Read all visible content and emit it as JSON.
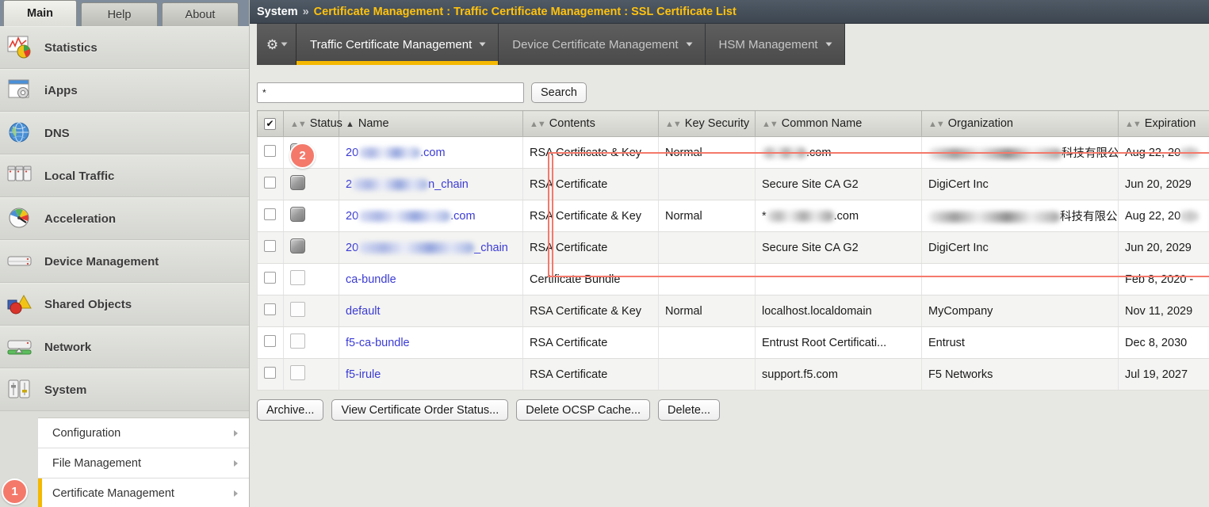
{
  "sidebar": {
    "tabs": [
      {
        "label": "Main",
        "active": true
      },
      {
        "label": "Help",
        "active": false
      },
      {
        "label": "About",
        "active": false
      }
    ],
    "modules": [
      {
        "label": "Statistics",
        "icon": "statistics-chart-icon"
      },
      {
        "label": "iApps",
        "icon": "iapps-window-gear-icon"
      },
      {
        "label": "DNS",
        "icon": "dns-globe-icon"
      },
      {
        "label": "Local Traffic",
        "icon": "local-traffic-servers-icon"
      },
      {
        "label": "Acceleration",
        "icon": "acceleration-gauge-icon"
      },
      {
        "label": "Device Management",
        "icon": "device-management-server-icon"
      },
      {
        "label": "Shared Objects",
        "icon": "shared-objects-shapes-icon"
      },
      {
        "label": "Network",
        "icon": "network-server-icon"
      },
      {
        "label": "System",
        "icon": "system-sliders-icon"
      }
    ],
    "submenu": [
      {
        "label": "Configuration",
        "highlight": false
      },
      {
        "label": "File Management",
        "highlight": false
      },
      {
        "label": "Certificate Management",
        "highlight": true
      }
    ]
  },
  "header": {
    "breadcrumb_root": "System",
    "breadcrumb_separator": "»",
    "breadcrumb_path": "Certificate Management : Traffic Certificate Management : SSL Certificate List"
  },
  "module_tabs": [
    {
      "label": "Traffic Certificate Management",
      "active": true
    },
    {
      "label": "Device Certificate Management",
      "active": false
    },
    {
      "label": "HSM Management",
      "active": false
    }
  ],
  "search": {
    "value": "*",
    "placeholder": "",
    "button_label": "Search"
  },
  "table": {
    "columns": [
      {
        "key": "checkbox",
        "label": "",
        "sort": "none"
      },
      {
        "key": "status",
        "label": "Status",
        "sort": "sortable"
      },
      {
        "key": "name",
        "label": "Name",
        "sort": "asc"
      },
      {
        "key": "contents",
        "label": "Contents",
        "sort": "sortable"
      },
      {
        "key": "key_security",
        "label": "Key Security",
        "sort": "sortable"
      },
      {
        "key": "common_name",
        "label": "Common Name",
        "sort": "sortable"
      },
      {
        "key": "organization",
        "label": "Organization",
        "sort": "sortable"
      },
      {
        "key": "expiration",
        "label": "Expiration",
        "sort": "sortable"
      }
    ],
    "header_checkbox_checked": true,
    "rows": [
      {
        "checked": false,
        "status_icon": "filled",
        "name_prefix": "20",
        "name_redacted": true,
        "name_redact_width": 78,
        "name_suffix": ".com",
        "contents": "RSA Certificate & Key",
        "key_security": "Normal",
        "cn_prefix": "",
        "cn_redacted": true,
        "cn_redact_width": 56,
        "cn_suffix": ".com",
        "org_redacted": true,
        "org_redact_width": 168,
        "org_suffix": "科技有限公司",
        "expiration": "Aug 22, 20",
        "expiration_redacted": true
      },
      {
        "checked": false,
        "status_icon": "filled",
        "name_prefix": "2",
        "name_redacted": true,
        "name_redact_width": 96,
        "name_suffix": "n_chain",
        "contents": "RSA Certificate",
        "key_security": "",
        "cn_prefix": "Secure Site CA G2",
        "cn_redacted": false,
        "cn_suffix": "",
        "org_redacted": false,
        "org_text": "DigiCert Inc",
        "expiration": "Jun 20, 2029",
        "expiration_redacted": false
      },
      {
        "checked": false,
        "status_icon": "filled",
        "name_prefix": "20",
        "name_redacted": true,
        "name_redact_width": 116,
        "name_suffix": ".com",
        "contents": "RSA Certificate & Key",
        "key_security": "Normal",
        "cn_prefix": "*",
        "cn_redacted": true,
        "cn_redact_width": 85,
        "cn_suffix": ".com",
        "org_redacted": true,
        "org_redact_width": 166,
        "org_suffix": "科技有限公司",
        "expiration": "Aug 22, 20",
        "expiration_redacted": true
      },
      {
        "checked": false,
        "status_icon": "filled",
        "name_prefix": "20",
        "name_redacted": true,
        "name_redact_width": 146,
        "name_suffix": "_chain",
        "contents": "RSA Certificate",
        "key_security": "",
        "cn_prefix": "Secure Site CA G2",
        "cn_redacted": false,
        "cn_suffix": "",
        "org_redacted": false,
        "org_text": "DigiCert Inc",
        "expiration": "Jun 20, 2029",
        "expiration_redacted": false
      },
      {
        "checked": false,
        "status_icon": "empty",
        "name_prefix": "ca-bundle",
        "name_redacted": false,
        "name_suffix": "",
        "contents": "Certificate Bundle",
        "key_security": "",
        "cn_prefix": "",
        "cn_redacted": false,
        "cn_suffix": "",
        "org_redacted": false,
        "org_text": "",
        "expiration": "Feb 8, 2020 - ",
        "expiration_redacted": false
      },
      {
        "checked": false,
        "status_icon": "empty",
        "name_prefix": "default",
        "name_redacted": false,
        "name_suffix": "",
        "contents": "RSA Certificate & Key",
        "key_security": "Normal",
        "cn_prefix": "localhost.localdomain",
        "cn_redacted": false,
        "cn_suffix": "",
        "org_redacted": false,
        "org_text": "MyCompany",
        "expiration": "Nov 11, 2029",
        "expiration_redacted": false
      },
      {
        "checked": false,
        "status_icon": "empty",
        "name_prefix": "f5-ca-bundle",
        "name_redacted": false,
        "name_suffix": "",
        "contents": "RSA Certificate",
        "key_security": "",
        "cn_prefix": "Entrust Root Certificati...",
        "cn_redacted": false,
        "cn_suffix": "",
        "org_redacted": false,
        "org_text": "Entrust",
        "expiration": "Dec 8, 2030",
        "expiration_redacted": false
      },
      {
        "checked": false,
        "status_icon": "empty",
        "name_prefix": "f5-irule",
        "name_redacted": false,
        "name_suffix": "",
        "contents": "RSA Certificate",
        "key_security": "",
        "cn_prefix": "support.f5.com",
        "cn_redacted": false,
        "cn_suffix": "",
        "org_redacted": false,
        "org_text": "F5 Networks",
        "expiration": "Jul 19, 2027",
        "expiration_redacted": false
      }
    ]
  },
  "actions": [
    {
      "label": "Archive..."
    },
    {
      "label": "View Certificate Order Status..."
    },
    {
      "label": "Delete OCSP Cache..."
    },
    {
      "label": "Delete..."
    }
  ],
  "annotations": [
    {
      "id": "1",
      "label": "1"
    },
    {
      "id": "2",
      "label": "2"
    }
  ],
  "colors": {
    "accent_yellow": "#f5b800",
    "breadcrumb_path": "#ffc20e",
    "annotation": "#f4796b",
    "link": "#3b3bd4",
    "header_bar": "#3d4650"
  }
}
